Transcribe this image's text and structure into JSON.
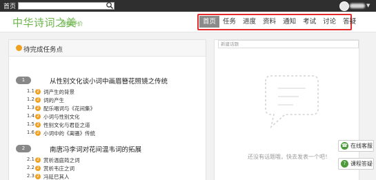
{
  "topbar": {
    "home": "首页",
    "user_name_blurred": ""
  },
  "header": {
    "site_title": "中华诗词之美",
    "course_link": "课程评价"
  },
  "nav": {
    "items": [
      {
        "label": "首页",
        "active": true
      },
      {
        "label": "任务",
        "active": false
      },
      {
        "label": "进度",
        "active": false
      },
      {
        "label": "资料",
        "active": false
      },
      {
        "label": "通知",
        "active": false
      },
      {
        "label": "考试",
        "active": false
      },
      {
        "label": "讨论",
        "active": false
      },
      {
        "label": "答疑",
        "active": false
      }
    ],
    "highlight_color": "#e52a2a"
  },
  "left": {
    "panel_title": "待完成任务点",
    "chapters": [
      {
        "num": "1",
        "title": "从性别文化谈小词中画眉簪花照镜之传统",
        "sections": [
          {
            "num": "1.1",
            "badge": "2",
            "title": "词产生的背景"
          },
          {
            "num": "1.2",
            "badge": "2",
            "title": "词的产生"
          },
          {
            "num": "1.3",
            "badge": "2",
            "title": "配乐唱词与《花间集》"
          },
          {
            "num": "1.4",
            "badge": "2",
            "title": "小词与性别文化"
          },
          {
            "num": "1.5",
            "badge": "2",
            "title": "性别文化与君臣之道"
          },
          {
            "num": "1.6",
            "badge": "2",
            "title": "小词中的《离骚》传统"
          }
        ]
      },
      {
        "num": "2",
        "title": "南唐冯李词对花间温韦词的拓展",
        "sections": [
          {
            "num": "2.1",
            "badge": "2",
            "title": "赏析温庭筠之词"
          },
          {
            "num": "2.2",
            "badge": "2",
            "title": "赏析韦庄之词"
          },
          {
            "num": "2.3",
            "badge": "2",
            "title": "冯延巳其人"
          }
        ]
      }
    ]
  },
  "right": {
    "topic_placeholder": "新建话题",
    "empty_text": "还没有话题哦，快去发表一个吧！"
  },
  "float": {
    "service": "在线客服",
    "qa": "课程答疑"
  },
  "colors": {
    "brand_green": "#6bb44a",
    "badge_orange": "#f0a01f"
  }
}
